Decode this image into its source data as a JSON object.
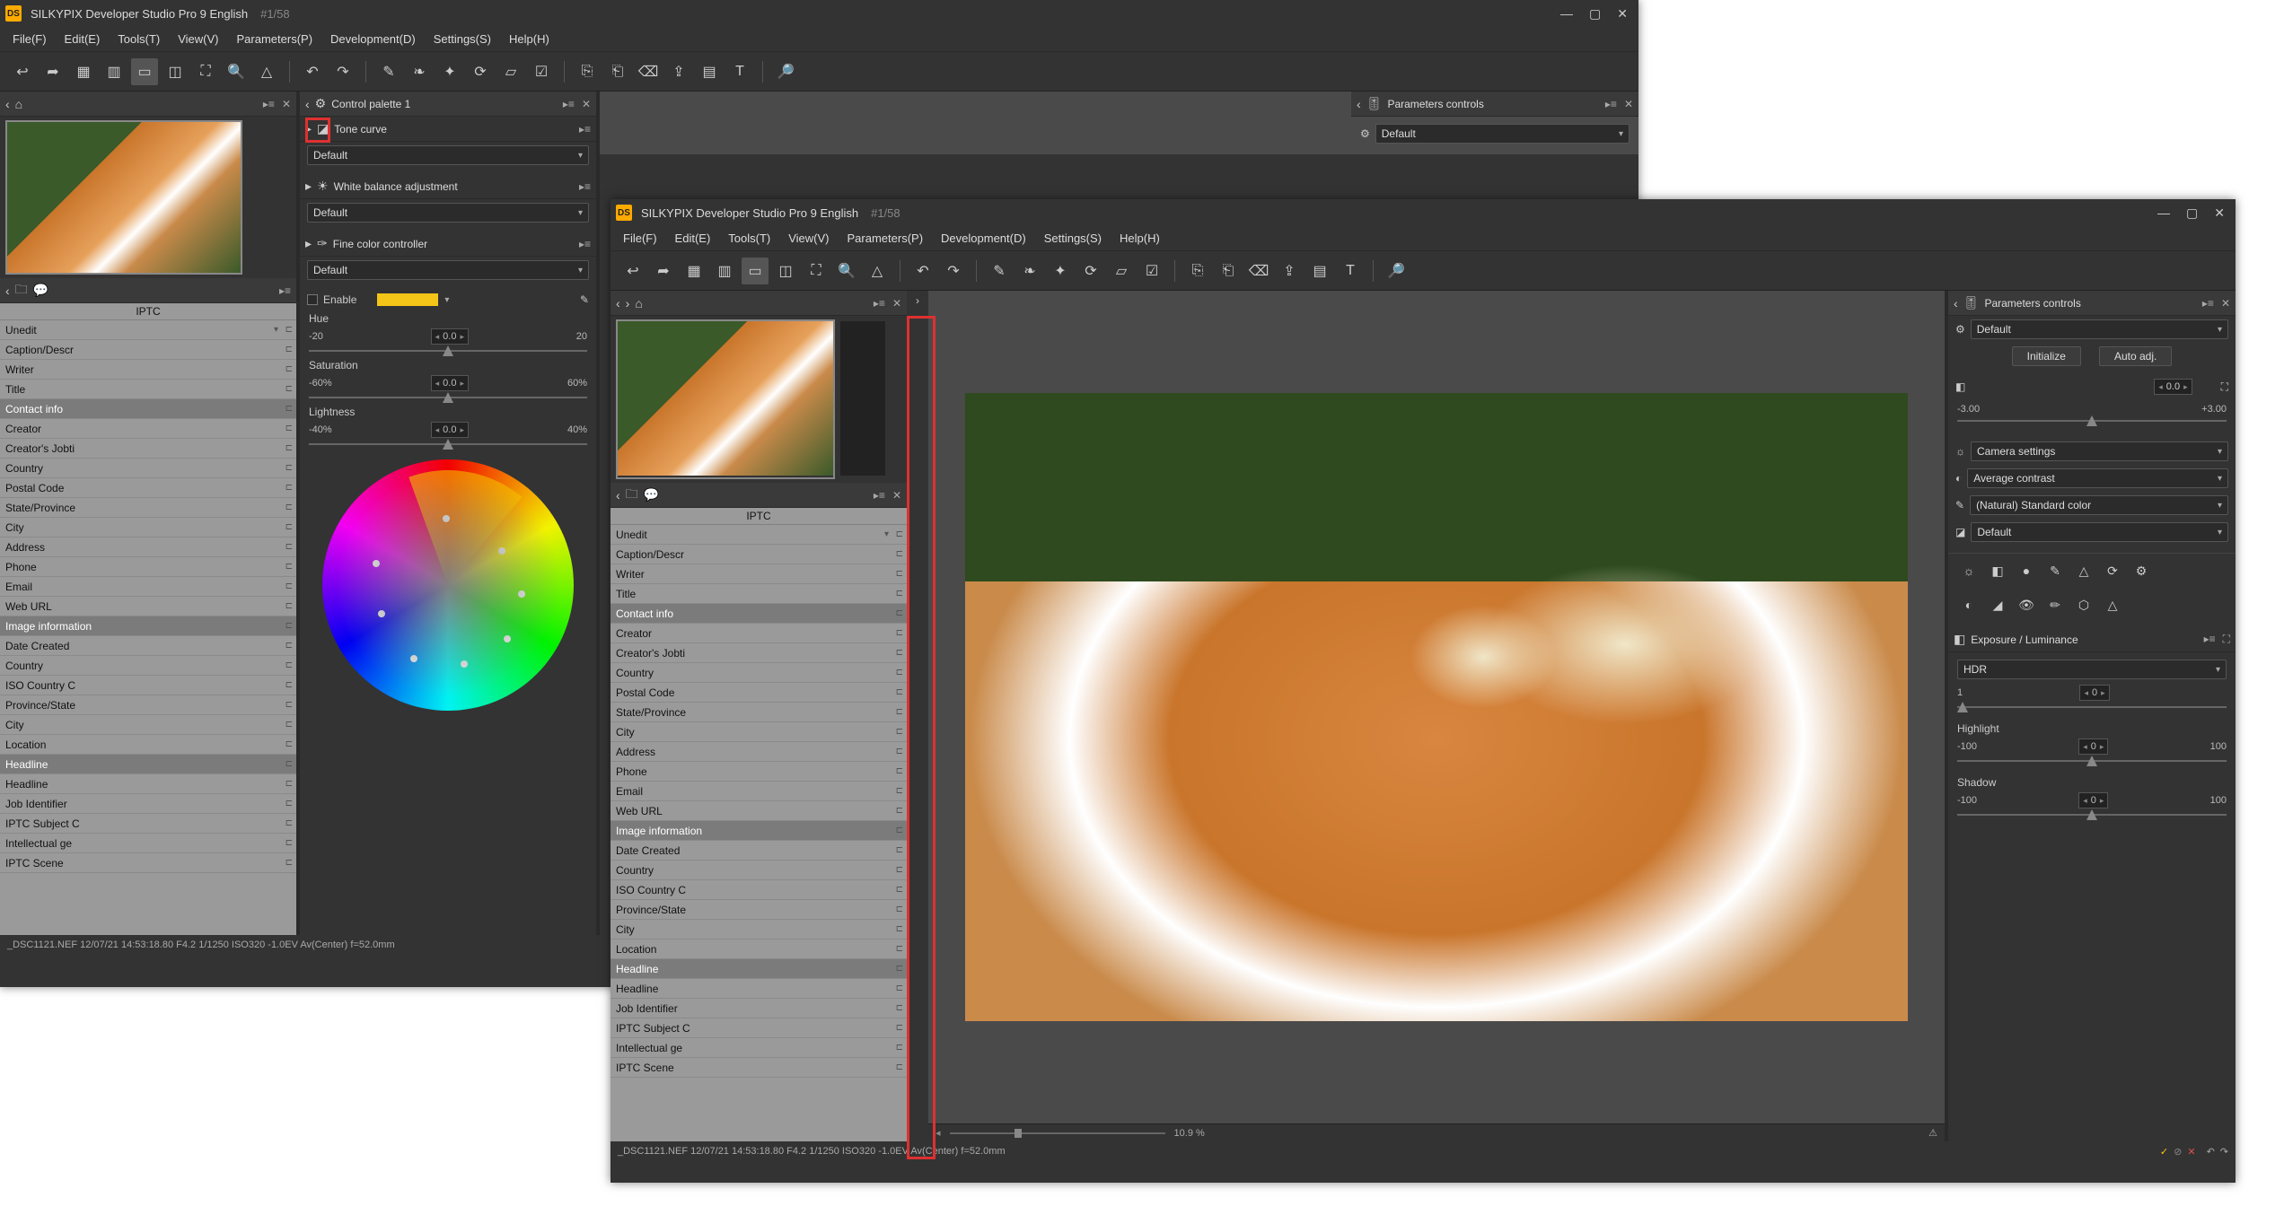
{
  "app": {
    "title": "SILKYPIX Developer Studio Pro 9 English",
    "counter": "#1/58"
  },
  "menu": {
    "items": [
      "File(F)",
      "Edit(E)",
      "Tools(T)",
      "View(V)",
      "Parameters(P)",
      "Development(D)",
      "Settings(S)",
      "Help(H)"
    ]
  },
  "panels": {
    "control_palette": "Control palette 1",
    "tone_curve": "Tone curve",
    "wb_adjust": "White balance adjustment",
    "fine_color": "Fine color controller",
    "parameters_controls": "Parameters controls",
    "exposure_luminance": "Exposure / Luminance"
  },
  "dropdowns": {
    "default": "Default",
    "camera_settings": "Camera settings",
    "average_contrast": "Average contrast",
    "standard_color": "(Natural) Standard color"
  },
  "fine_color": {
    "enable_label": "Enable",
    "hue": {
      "label": "Hue",
      "min": "-20",
      "max": "20",
      "value": "0.0"
    },
    "saturation": {
      "label": "Saturation",
      "min": "-60%",
      "max": "60%",
      "value": "0.0"
    },
    "lightness": {
      "label": "Lightness",
      "min": "-40%",
      "max": "40%",
      "value": "0.0"
    }
  },
  "iptc": {
    "title": "IPTC",
    "items": [
      "Unedit",
      "Caption/Descr",
      "Writer",
      "Title",
      "Contact info",
      "Creator",
      "Creator's Jobti",
      "Country",
      "Postal Code",
      "State/Province",
      "City",
      "Address",
      "Phone",
      "Email",
      "Web URL",
      "Image information",
      "Date Created",
      "Country",
      "ISO Country C",
      "Province/State",
      "City",
      "Location",
      "Headline",
      "Headline",
      "Job Identifier",
      "IPTC Subject C",
      "Intellectual ge",
      "IPTC Scene"
    ],
    "highlights": [
      "Contact info",
      "Image information",
      "Headline"
    ]
  },
  "right": {
    "initialize": "Initialize",
    "auto_adj": "Auto adj.",
    "ev": {
      "value": "0.0",
      "min": "-3.00",
      "max": "+3.00"
    },
    "hdr": {
      "label": "HDR",
      "value": "0",
      "min": "1"
    },
    "highlight": {
      "label": "Highlight",
      "value": "0",
      "min": "-100",
      "max": "100"
    },
    "shadow": {
      "label": "Shadow",
      "value": "0",
      "min": "-100",
      "max": "100"
    }
  },
  "zoom": {
    "value": "10.9",
    "unit": "%"
  },
  "status": {
    "line": "_DSC1121.NEF 12/07/21 14:53:18.80 F4.2 1/1250 ISO320 -1.0EV Av(Center) f=52.0mm"
  },
  "status_dots": [
    "#4caf50",
    "#f44336",
    "#ffffff",
    "#4caf50",
    "#3f51b5",
    "#9c27b0",
    "#ffeb3b",
    "#ff9800"
  ]
}
